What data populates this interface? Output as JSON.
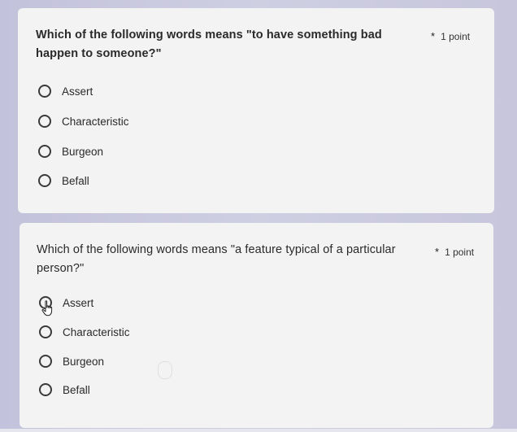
{
  "questions": [
    {
      "text": "Which of the following words means \"to have something bad happen to someone?\"",
      "required_marker": "*",
      "points": "1 point",
      "options": [
        "Assert",
        "Characteristic",
        "Burgeon",
        "Befall"
      ]
    },
    {
      "text": "Which of the following words means \"a feature typical of a particular person?\"",
      "required_marker": "*",
      "points": "1 point",
      "options": [
        "Assert",
        "Characteristic",
        "Burgeon",
        "Befall"
      ]
    }
  ]
}
